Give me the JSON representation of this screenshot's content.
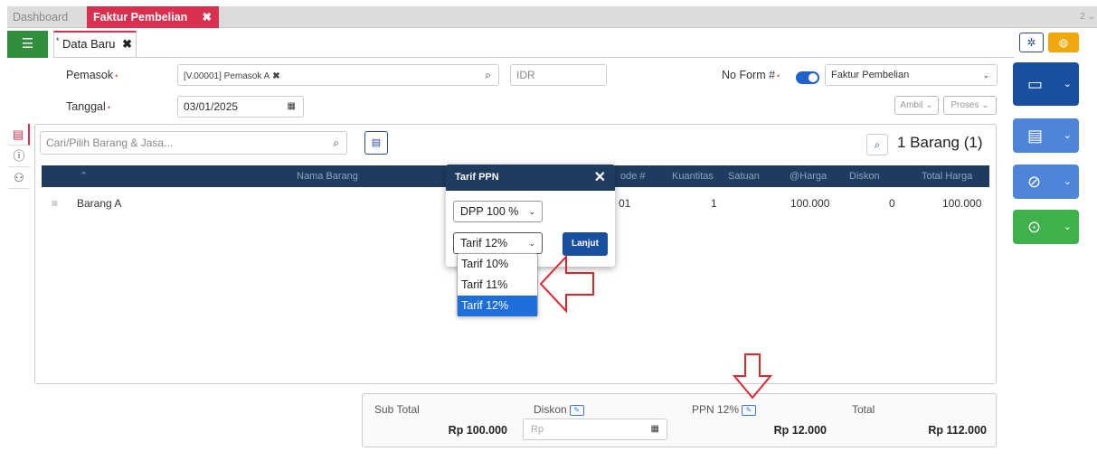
{
  "tabs": {
    "dashboard": "Dashboard",
    "active": "Faktur Pembelian",
    "close": "✖",
    "top_right": "2 ⌄"
  },
  "subtab": {
    "label": "Data Baru",
    "marker": "*",
    "close": "✖"
  },
  "form": {
    "supplier_label": "Pemasok",
    "supplier_value": "[V.00001] Pemasok A",
    "supplier_clear": "✖",
    "currency": "IDR",
    "date_label": "Tanggal",
    "date_value": "03/01/2025",
    "form_no_label": "No Form #",
    "form_type": "Faktur Pembelian",
    "take_button": "Ambil ⌄",
    "process_button": "Proses ⌄",
    "required_mark": "•"
  },
  "items": {
    "search_placeholder": "Cari/Pilih Barang & Jasa...",
    "count_label": "1 Barang (1)",
    "columns": {
      "sort": "⌃",
      "name": "Nama Barang",
      "code": "ode #",
      "qty": "Kuantitas",
      "unit": "Satuan",
      "price": "@Harga",
      "discount": "Diskon",
      "total": "Total Harga"
    },
    "rows": [
      {
        "name": "Barang A",
        "code": "01",
        "qty": "1",
        "unit": "",
        "price": "100.000",
        "discount": "0",
        "total": "100.000"
      }
    ]
  },
  "totals": {
    "subtotal_label": "Sub Total",
    "subtotal_value": "Rp 100.000",
    "discount_label": "Diskon",
    "discount_placeholder": "Rp",
    "ppn_label": "PPN 12%",
    "ppn_value": "Rp 12.000",
    "total_label": "Total",
    "total_value": "Rp 112.000"
  },
  "modal": {
    "title": "Tarif PPN",
    "close": "✕",
    "dpp_select": "DPP 100 %",
    "tarif_select": "Tarif 12%",
    "continue_button": "Lanjut",
    "tarif_options": [
      "Tarif 10%",
      "Tarif 11%",
      "Tarif 12%"
    ],
    "selected_option": "Tarif 12%"
  },
  "colors": {
    "accent_red": "#d9304f",
    "navy": "#1f3b5f",
    "primary_blue": "#1a4f9f",
    "green": "#3fb14b",
    "annotation_red": "#e0242b"
  }
}
